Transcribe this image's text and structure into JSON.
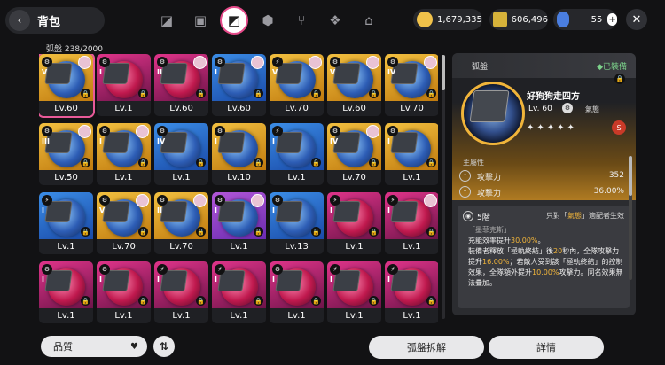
{
  "header": {
    "back_icon": "back-arrow-icon",
    "title": "背包"
  },
  "tabs": [
    {
      "icon": "n-logo-icon",
      "glyph": "◪"
    },
    {
      "icon": "device-icon",
      "glyph": "▣"
    },
    {
      "icon": "disk-drive-icon",
      "glyph": "◩",
      "active": true
    },
    {
      "icon": "cube-icon",
      "glyph": "⬢"
    },
    {
      "icon": "utensils-icon",
      "glyph": "⑂"
    },
    {
      "icon": "package-icon",
      "glyph": "❖"
    },
    {
      "icon": "home-icon",
      "glyph": "⌂"
    }
  ],
  "currencies": {
    "gold": "1,679,335",
    "tickets": "606,496",
    "gems": "55",
    "plus": "+"
  },
  "close_glyph": "✕",
  "inventory": {
    "label": "弧盤",
    "count": "238/2000"
  },
  "items": [
    {
      "lv": "Lv.60",
      "rank": "⚙",
      "roman": "V",
      "rarity": "gold",
      "avatar": true,
      "selected": true
    },
    {
      "lv": "Lv.1",
      "rank": "⚙",
      "roman": "I",
      "rarity": "pink",
      "avatar": false
    },
    {
      "lv": "Lv.60",
      "rank": "⚙",
      "roman": "II",
      "rarity": "pink",
      "avatar": true
    },
    {
      "lv": "Lv.60",
      "rank": "⚙",
      "roman": "I",
      "rarity": "blue",
      "avatar": true
    },
    {
      "lv": "Lv.70",
      "rank": "⚡",
      "roman": "V",
      "rarity": "gold",
      "avatar": true
    },
    {
      "lv": "Lv.60",
      "rank": "⚙",
      "roman": "V",
      "rarity": "gold",
      "avatar": true
    },
    {
      "lv": "Lv.70",
      "rank": "⚙",
      "roman": "IV",
      "rarity": "gold",
      "avatar": true
    },
    {
      "lv": "Lv.50",
      "rank": "⚙",
      "roman": "III",
      "rarity": "gold",
      "avatar": true
    },
    {
      "lv": "Lv.1",
      "rank": "⚙",
      "roman": "I",
      "rarity": "gold",
      "avatar": true
    },
    {
      "lv": "Lv.1",
      "rank": "⚙",
      "roman": "IV",
      "rarity": "blue",
      "avatar": false
    },
    {
      "lv": "Lv.10",
      "rank": "⚙",
      "roman": "I",
      "rarity": "gold",
      "avatar": false
    },
    {
      "lv": "Lv.1",
      "rank": "⚡",
      "roman": "I",
      "rarity": "blue",
      "avatar": false
    },
    {
      "lv": "Lv.70",
      "rank": "⚙",
      "roman": "IV",
      "rarity": "gold",
      "avatar": true
    },
    {
      "lv": "Lv.1",
      "rank": "⚙",
      "roman": "I",
      "rarity": "gold",
      "avatar": false
    },
    {
      "lv": "Lv.1",
      "rank": "⚡",
      "roman": "I",
      "rarity": "blue",
      "avatar": false
    },
    {
      "lv": "Lv.70",
      "rank": "⚙",
      "roman": "V",
      "rarity": "gold",
      "avatar": true
    },
    {
      "lv": "Lv.70",
      "rank": "⚙",
      "roman": "II",
      "rarity": "gold",
      "avatar": true
    },
    {
      "lv": "Lv.1",
      "rank": "⚙",
      "roman": "I",
      "rarity": "purple",
      "avatar": true
    },
    {
      "lv": "Lv.13",
      "rank": "⚙",
      "roman": "I",
      "rarity": "blue",
      "avatar": false
    },
    {
      "lv": "Lv.1",
      "rank": "⚡",
      "roman": "I",
      "rarity": "pink",
      "avatar": false
    },
    {
      "lv": "Lv.1",
      "rank": "⚡",
      "roman": "I",
      "rarity": "pink",
      "avatar": true
    },
    {
      "lv": "Lv.1",
      "rank": "⚙",
      "roman": "I",
      "rarity": "pink",
      "avatar": false
    },
    {
      "lv": "Lv.1",
      "rank": "⚙",
      "roman": "I",
      "rarity": "pink",
      "avatar": false
    },
    {
      "lv": "Lv.1",
      "rank": "⚡",
      "roman": "I",
      "rarity": "pink",
      "avatar": false
    },
    {
      "lv": "Lv.1",
      "rank": "⚡",
      "roman": "I",
      "rarity": "pink",
      "avatar": false
    },
    {
      "lv": "Lv.1",
      "rank": "⚙",
      "roman": "I",
      "rarity": "pink",
      "avatar": false
    },
    {
      "lv": "Lv.1",
      "rank": "⚡",
      "roman": "I",
      "rarity": "pink",
      "avatar": false
    },
    {
      "lv": "Lv.1",
      "rank": "⚡",
      "roman": "I",
      "rarity": "pink",
      "avatar": false
    }
  ],
  "lock_glyph": "🔒",
  "detail": {
    "header": "弧盤",
    "equipped": "◆已裝備",
    "name": "好狗狗走四方",
    "level": "Lv. 60",
    "faction_glyph": "⚙",
    "faction": "氣態",
    "stars": "✦✦✦✦✦",
    "rank_glyph": "S",
    "main_stat_title": "主屬性",
    "stats": [
      {
        "name": "攻擊力",
        "value": "352"
      },
      {
        "name": "攻擊力",
        "value": "36.00%"
      }
    ],
    "effect": {
      "tier": "5階",
      "req_prefix": "只對「",
      "req_key": "氣態",
      "req_suffix": "」適配者生效",
      "source": "「墨菲克斯」",
      "line1": "充能效率提升",
      "line1_val": "30.00%",
      "line1_end": "。",
      "line2": "裝備者釋放「極軌終結」後",
      "line2_val": "20",
      "line2_end": "秒內，全隊攻擊力提升",
      "line3_val": "16.00%",
      "line3_end": "；若敵人受到該「極軌終結」的控制效果，全隊額外提升",
      "line4_val": "10.00%",
      "line4_end": "攻擊力。同名效果無法疊加。"
    }
  },
  "bottom": {
    "sort_label": "品質",
    "sort_arrow": "♥",
    "order_glyph": "⇅",
    "dismantle": "弧盤拆解",
    "details": "詳情"
  },
  "colors": {
    "accent": "#e64a8a",
    "gold": "#f0b43a",
    "equipped": "#7cd28b"
  }
}
